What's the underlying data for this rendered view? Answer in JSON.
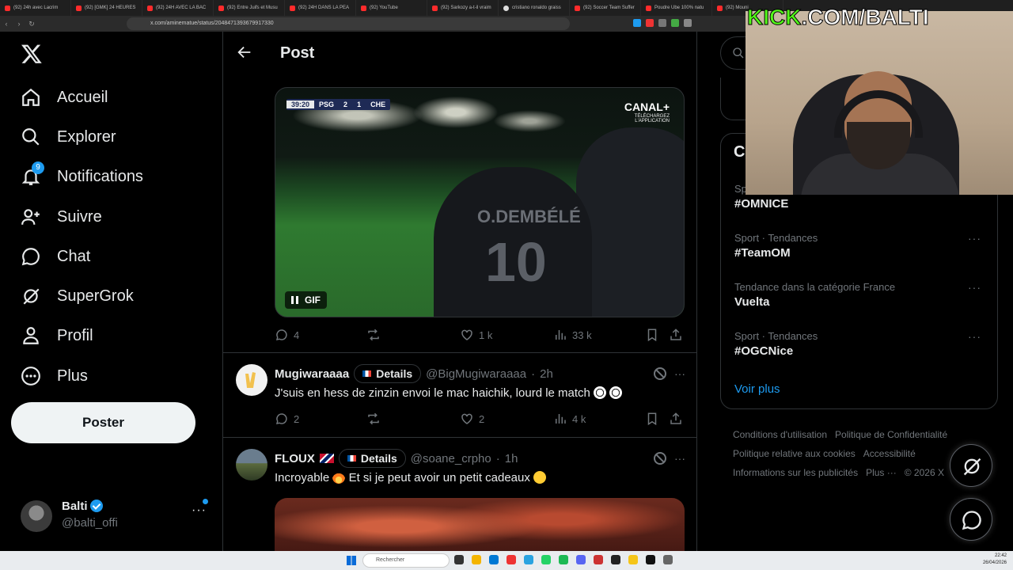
{
  "browser": {
    "tabs": [
      {
        "label": "(92) 24h avec Lacrim"
      },
      {
        "label": "(92) [GMK] 24 HEURES"
      },
      {
        "label": "(92) 24H AVEC LA BAC"
      },
      {
        "label": "(92) Entre Juifs et Musu"
      },
      {
        "label": "(92) 24H DANS LA PEA"
      },
      {
        "label": "(92) YouTube"
      },
      {
        "label": "(92) Sarkozy a-t-il vraim"
      },
      {
        "label": "cristiano ronaldo graiss"
      },
      {
        "label": "(92) Soccer Team Suffer"
      },
      {
        "label": "Poudre Ube 100% natu"
      },
      {
        "label": "(92) Mouni"
      }
    ],
    "url": "x.com/aminematue/status/2048471393679917330"
  },
  "sidebar": {
    "items": [
      {
        "label": "Accueil"
      },
      {
        "label": "Explorer"
      },
      {
        "label": "Notifications",
        "badge": "9"
      },
      {
        "label": "Suivre"
      },
      {
        "label": "Chat"
      },
      {
        "label": "SuperGrok"
      },
      {
        "label": "Profil"
      },
      {
        "label": "Plus"
      }
    ],
    "post_button": "Poster",
    "account": {
      "name": "Balti",
      "handle": "@balti_offi"
    }
  },
  "header": {
    "title": "Post"
  },
  "gif": {
    "clock": "39:20",
    "home": "PSG",
    "score_home": "2",
    "score_away": "1",
    "away": "CHE",
    "broadcaster": "CANAL+",
    "broadcaster_sub": "TÉLÉCHARGEZ L'APPLICATION",
    "jersey_name": "O.DEMBÉLÉ",
    "jersey_number": "10",
    "label": "GIF"
  },
  "main_post_stats": {
    "replies": "4",
    "likes": "1 k",
    "views": "33 k"
  },
  "replies": [
    {
      "name": "Mugiwaraaaa",
      "details_label": "Details",
      "handle": "@BigMugiwaraaaa",
      "time": "2h",
      "text": "J'suis en hess de zinzin envoi le mac haichik, lourd le match",
      "replies": "2",
      "likes": "2",
      "views": "4 k"
    },
    {
      "name": "FLOUX",
      "details_label": "Details",
      "handle": "@soane_crpho",
      "time": "1h",
      "text_a": "Incroyable",
      "text_b": "Et si je peut avoir un petit cadeaux"
    }
  ],
  "right": {
    "trends_title": "C",
    "trends": [
      {
        "meta": "Sp",
        "name": "#OMNICE"
      },
      {
        "meta": "Sport · Tendances",
        "name": "#TeamOM"
      },
      {
        "meta": "Tendance dans la catégorie France",
        "name": "Vuelta"
      },
      {
        "meta": "Sport · Tendances",
        "name": "#OGCNice"
      }
    ],
    "see_more": "Voir plus",
    "footer": [
      "Conditions d'utilisation",
      "Politique de Confidentialité",
      "Politique relative aux cookies",
      "Accessibilité",
      "Informations sur les publicités",
      "Plus ···",
      "© 2026 X"
    ]
  },
  "stream": {
    "overlay_kick": "KICK",
    "overlay_rest": ".COM/BALTI"
  },
  "taskbar": {
    "search_placeholder": "Rechercher",
    "time": "22:42",
    "date": "26/04/2026"
  },
  "colors": {
    "accent": "#1d9bf0",
    "kick_green": "#53fc18",
    "background": "#000000"
  }
}
